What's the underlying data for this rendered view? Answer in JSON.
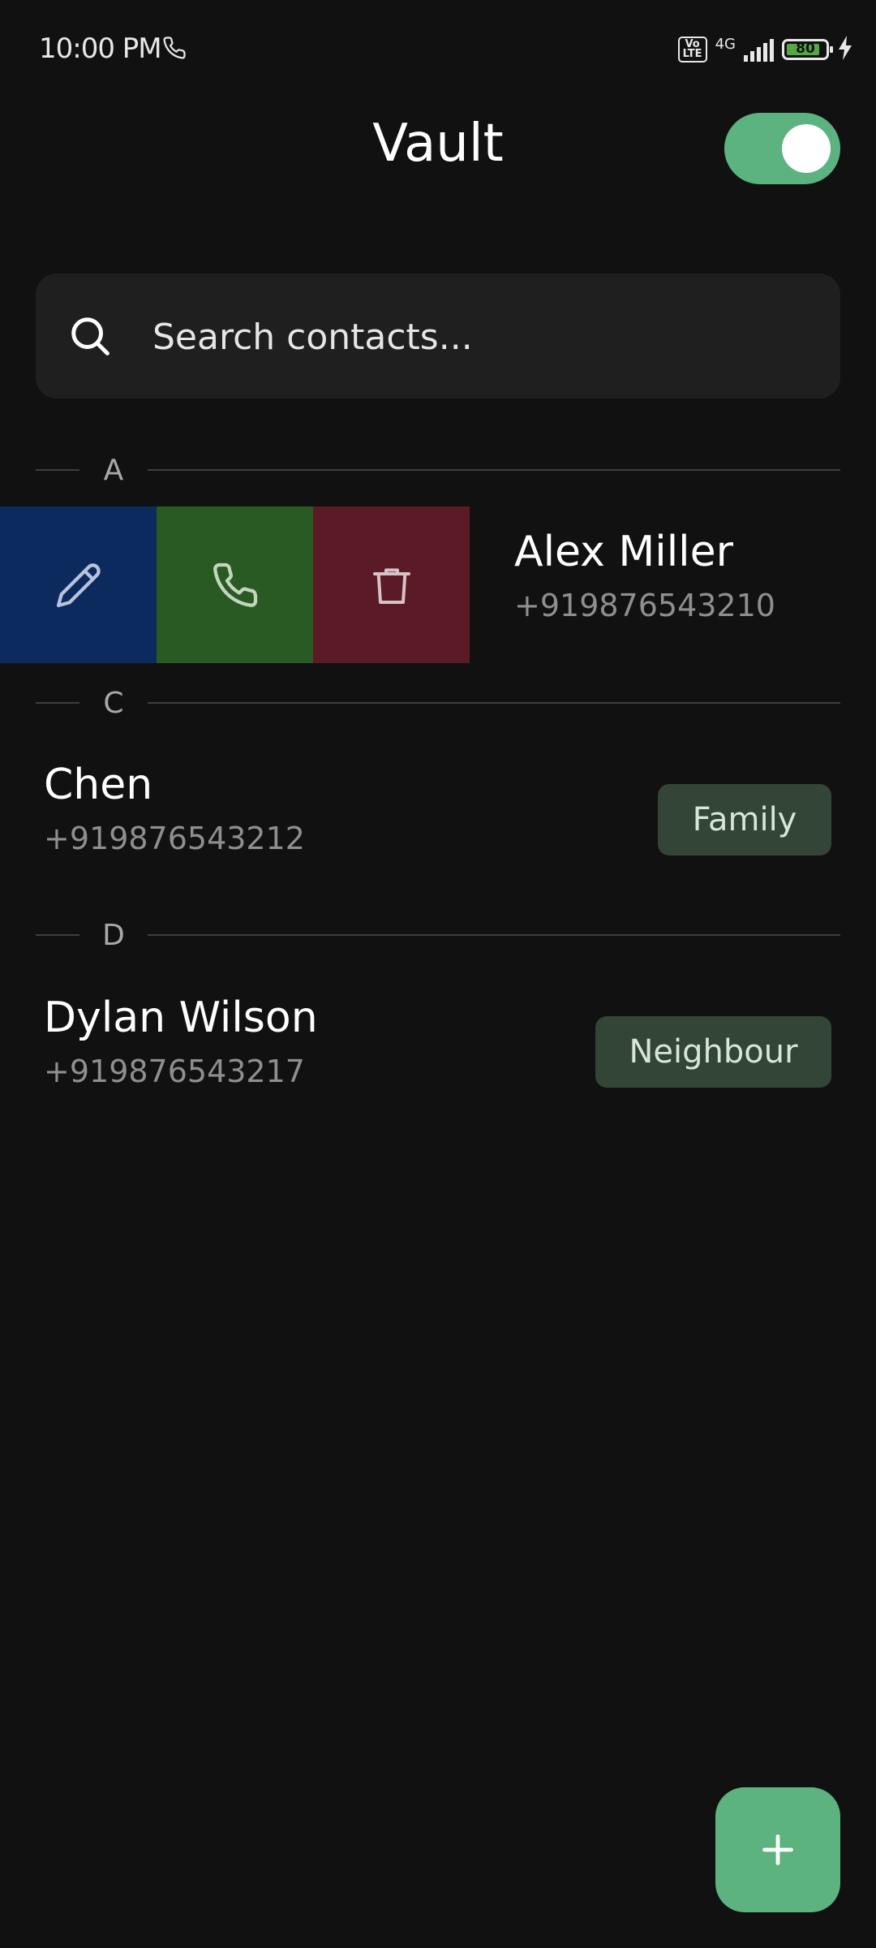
{
  "status_bar": {
    "time": "10:00 PM",
    "volte": "Vo LTE",
    "network": "4G",
    "battery_level": "80"
  },
  "header": {
    "title": "Vault",
    "toggle_on": true
  },
  "search": {
    "placeholder": "Search contacts..."
  },
  "sections": [
    {
      "letter": "A"
    },
    {
      "letter": "C"
    },
    {
      "letter": "D"
    }
  ],
  "swipe_actions": [
    {
      "name": "edit",
      "icon": "pencil-icon",
      "color": "#0d2a5e"
    },
    {
      "name": "call",
      "icon": "phone-icon",
      "color": "#2a5a24"
    },
    {
      "name": "delete",
      "icon": "trash-icon",
      "color": "#5a1a26"
    }
  ],
  "contacts": [
    {
      "name": "Alex Miller",
      "phone": "+919876543210",
      "tag": ""
    },
    {
      "name": "Chen",
      "phone": "+919876543212",
      "tag": "Family"
    },
    {
      "name": "Dylan Wilson",
      "phone": "+919876543217",
      "tag": "Neighbour"
    }
  ],
  "fab": {
    "icon": "plus-icon",
    "color": "#5cb380"
  },
  "colors": {
    "background": "#111111",
    "accent": "#5cb380",
    "tag_bg": "#334536"
  }
}
